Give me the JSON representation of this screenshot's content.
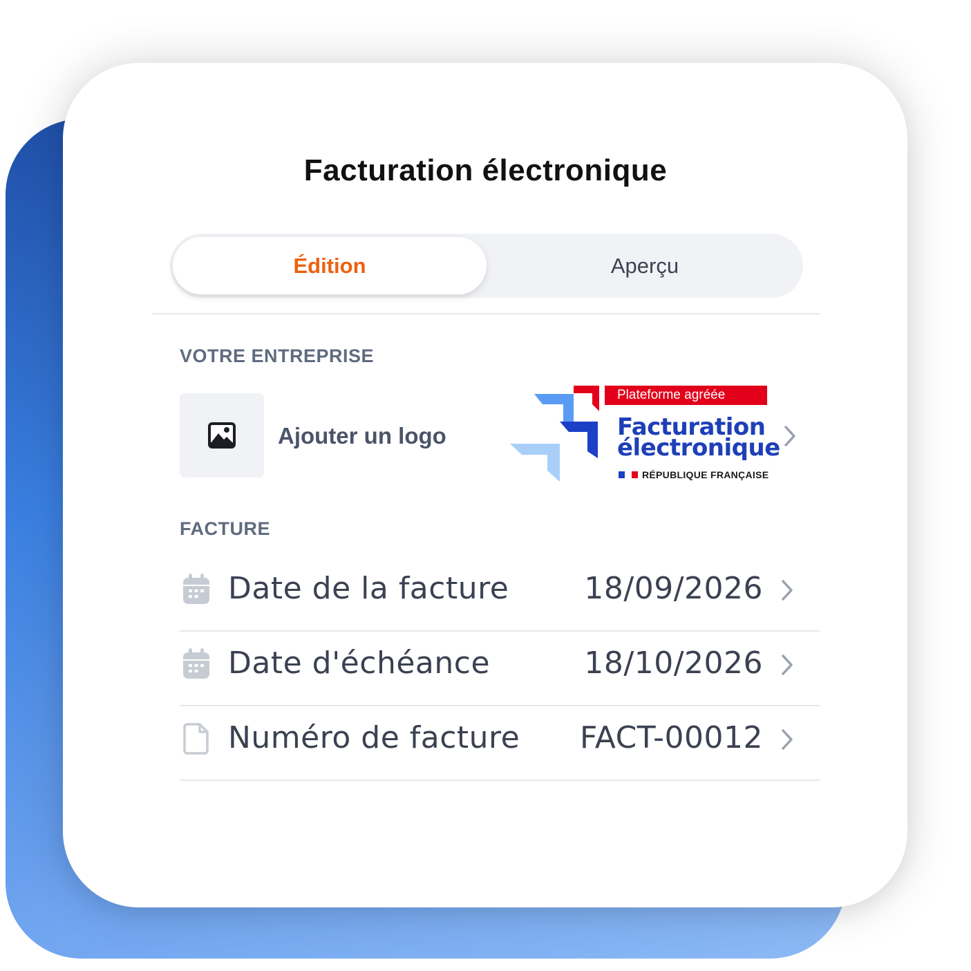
{
  "title": "Facturation électronique",
  "tabs": [
    {
      "label": "Édition",
      "active": true
    },
    {
      "label": "Aperçu",
      "active": false
    }
  ],
  "company": {
    "section_label": "VOTRE ENTREPRISE",
    "add_logo_label": "Ajouter un logo",
    "add_logo_icon": "image-icon",
    "badge": {
      "ribbon": "Plateforme agréée",
      "line1": "Facturation",
      "line2": "électronique",
      "republic": "RÉPUBLIQUE FRANÇAISE"
    }
  },
  "invoice": {
    "section_label": "FACTURE",
    "rows": [
      {
        "label": "Date de la facture",
        "value": "18/09/2026",
        "icon": "calendar-icon"
      },
      {
        "label": "Date d'échéance",
        "value": "18/10/2026",
        "icon": "calendar-icon"
      },
      {
        "label": "Numéro de facture",
        "value": "FACT-00012",
        "icon": "document-icon"
      }
    ]
  },
  "colors": {
    "accent": "#f0600f",
    "text": "#3b4151",
    "muted": "#5f6b7e",
    "badge_blue": "#1f3fb8",
    "badge_red": "#e2001a"
  }
}
